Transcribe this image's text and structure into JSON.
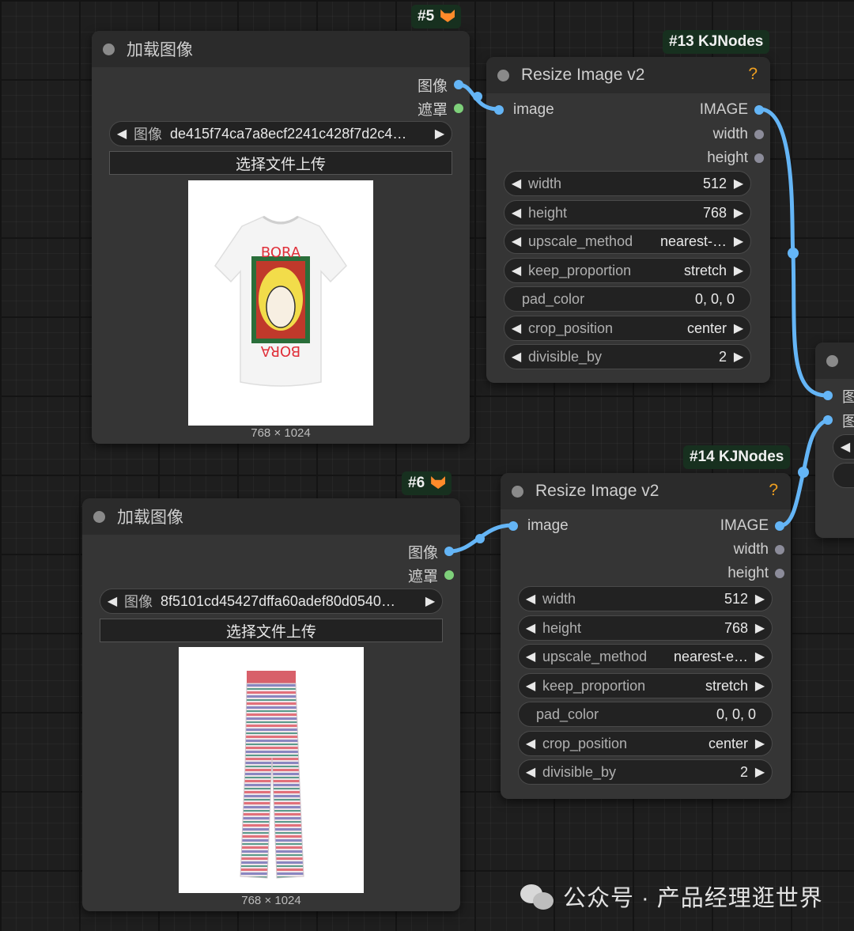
{
  "node5": {
    "badge": "#5",
    "title": "加载图像",
    "outputs": [
      "图像",
      "遮罩"
    ],
    "image_selector": {
      "label": "图像",
      "value": "de415f74ca7a8ecf2241c428f7d2c4…"
    },
    "upload_label": "选择文件上传",
    "dims": "768 × 1024"
  },
  "node6": {
    "badge": "#6",
    "title": "加载图像",
    "outputs": [
      "图像",
      "遮罩"
    ],
    "image_selector": {
      "label": "图像",
      "value": "8f5101cd45427dffa60adef80d0540…"
    },
    "upload_label": "选择文件上传",
    "dims": "768 × 1024"
  },
  "node13": {
    "badge": "#13 KJNodes",
    "title": "Resize Image v2",
    "help": "?",
    "input": "image",
    "outputs": [
      "IMAGE",
      "width",
      "height"
    ],
    "widgets": [
      {
        "label": "width",
        "value": "512"
      },
      {
        "label": "height",
        "value": "768"
      },
      {
        "label": "upscale_method",
        "value": "nearest-…"
      },
      {
        "label": "keep_proportion",
        "value": "stretch"
      },
      {
        "label": "pad_color",
        "value": "0, 0, 0"
      },
      {
        "label": "crop_position",
        "value": "center"
      },
      {
        "label": "divisible_by",
        "value": "2"
      }
    ]
  },
  "node14": {
    "badge": "#14 KJNodes",
    "title": "Resize Image v2",
    "help": "?",
    "input": "image",
    "outputs": [
      "IMAGE",
      "width",
      "height"
    ],
    "widgets": [
      {
        "label": "width",
        "value": "512"
      },
      {
        "label": "height",
        "value": "768"
      },
      {
        "label": "upscale_method",
        "value": "nearest-e…"
      },
      {
        "label": "keep_proportion",
        "value": "stretch"
      },
      {
        "label": "pad_color",
        "value": "0, 0, 0"
      },
      {
        "label": "crop_position",
        "value": "center"
      },
      {
        "label": "divisible_by",
        "value": "2"
      }
    ]
  },
  "partial_node": {
    "inputs": [
      "图",
      "图"
    ]
  },
  "watermark": "公众号 · 产品经理逛世界",
  "colors": {
    "link": "#64b5f6",
    "accent": "#f0a020",
    "badge_bg": "#17301f"
  }
}
